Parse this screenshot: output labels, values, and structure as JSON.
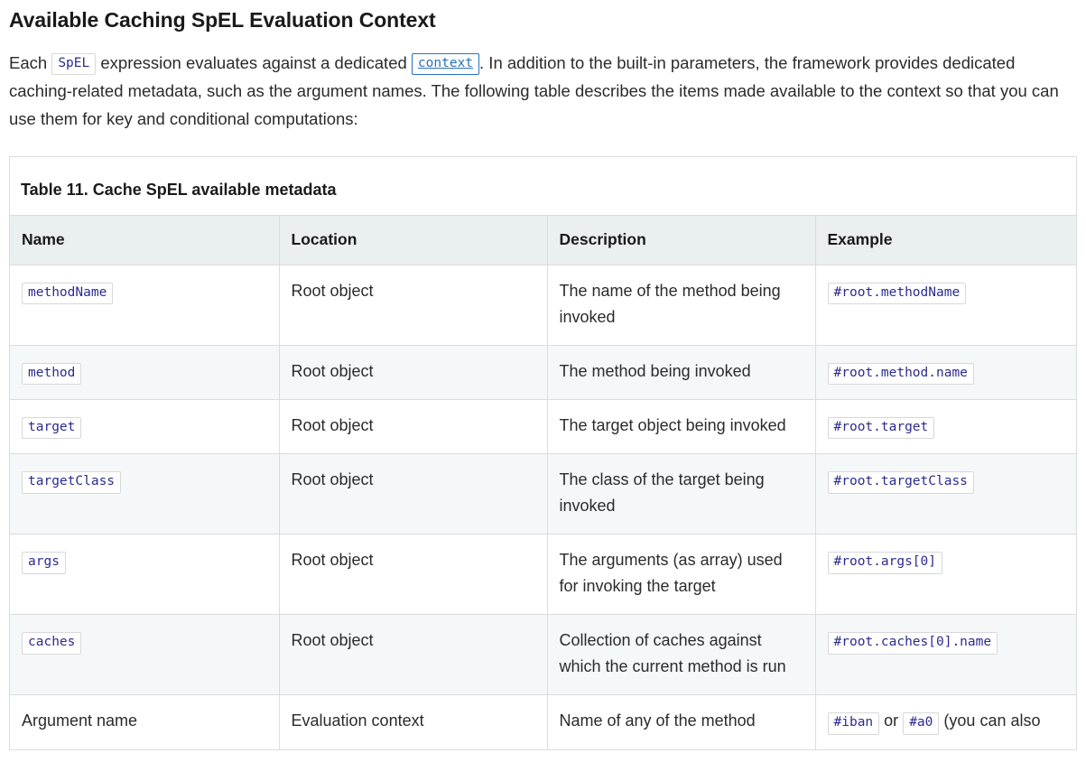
{
  "heading": "Available Caching SpEL Evaluation Context",
  "intro": {
    "part1": "Each",
    "chip_spel": "SpEL",
    "part2": "expression evaluates against a dedicated",
    "chip_context": "context",
    "part3": ". In addition to the built-in parameters, the framework provides dedicated caching-related metadata, such as the argument names. The following table describes the items made available to the context so that you can use them for key and conditional computations:"
  },
  "table": {
    "caption": "Table 11. Cache SpEL available metadata",
    "columns": [
      "Name",
      "Location",
      "Description",
      "Example"
    ],
    "rows": [
      {
        "name": "methodName",
        "name_is_code": true,
        "location": "Root object",
        "description": "The name of the method being invoked",
        "example": "#root.methodName",
        "example_extra": ""
      },
      {
        "name": "method",
        "name_is_code": true,
        "location": "Root object",
        "description": "The method being invoked",
        "example": "#root.method.name",
        "example_extra": ""
      },
      {
        "name": "target",
        "name_is_code": true,
        "location": "Root object",
        "description": "The target object being invoked",
        "example": "#root.target",
        "example_extra": ""
      },
      {
        "name": "targetClass",
        "name_is_code": true,
        "location": "Root object",
        "description": "The class of the target being invoked",
        "example": "#root.targetClass",
        "example_extra": ""
      },
      {
        "name": "args",
        "name_is_code": true,
        "location": "Root object",
        "description": "The arguments (as array) used for invoking the target",
        "example": "#root.args[0]",
        "example_extra": ""
      },
      {
        "name": "caches",
        "name_is_code": true,
        "location": "Root object",
        "description": "Collection of caches against which the current method is run",
        "example": "#root.caches[0].name",
        "example_extra": ""
      },
      {
        "name": "Argument name",
        "name_is_code": false,
        "location": "Evaluation context",
        "description": "Name of any of the method",
        "example": "#iban",
        "example_mid": "or",
        "example2": "#a0",
        "example_extra": "(you can also"
      }
    ]
  },
  "colors": {
    "code_text": "#2b2b8f",
    "link": "#2673b8",
    "header_bg": "#eaeff0",
    "stripe_bg": "#f4f8f8",
    "border": "#dcdcdc"
  }
}
